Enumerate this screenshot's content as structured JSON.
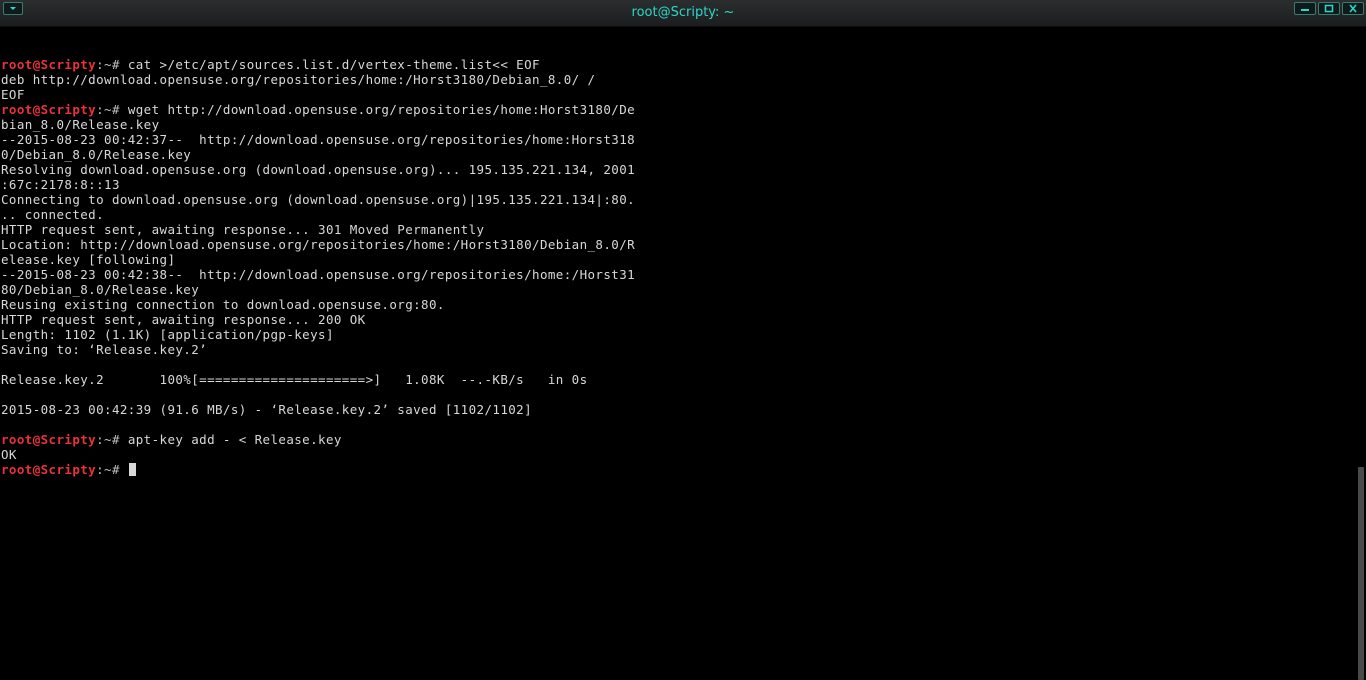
{
  "window": {
    "title": "root@Scripty: ~"
  },
  "icons": {
    "menu": "chevron-down-icon",
    "minimize": "minimize-icon",
    "maximize": "maximize-icon",
    "close": "close-icon"
  },
  "colors": {
    "title": "#2fd6c8",
    "prompt_user": "#e8333a",
    "text": "#d8d8d8",
    "background": "#000000"
  },
  "terminal": {
    "prompt": {
      "user": "root",
      "host": "@Scripty",
      "suffix": ":~#"
    },
    "lines": [
      {
        "cmd": " cat >/etc/apt/sources.list.d/vertex-theme.list<< EOF"
      },
      {
        "text": "deb http://download.opensuse.org/repositories/home:/Horst3180/Debian_8.0/ /"
      },
      {
        "text": "EOF"
      },
      {
        "cmd": " wget http://download.opensuse.org/repositories/home:Horst3180/De"
      },
      {
        "text": "bian_8.0/Release.key"
      },
      {
        "text": "--2015-08-23 00:42:37--  http://download.opensuse.org/repositories/home:Horst318"
      },
      {
        "text": "0/Debian_8.0/Release.key"
      },
      {
        "text": "Resolving download.opensuse.org (download.opensuse.org)... 195.135.221.134, 2001"
      },
      {
        "text": ":67c:2178:8::13"
      },
      {
        "text": "Connecting to download.opensuse.org (download.opensuse.org)|195.135.221.134|:80."
      },
      {
        "text": ".. connected."
      },
      {
        "text": "HTTP request sent, awaiting response... 301 Moved Permanently"
      },
      {
        "text": "Location: http://download.opensuse.org/repositories/home:/Horst3180/Debian_8.0/R"
      },
      {
        "text": "elease.key [following]"
      },
      {
        "text": "--2015-08-23 00:42:38--  http://download.opensuse.org/repositories/home:/Horst31"
      },
      {
        "text": "80/Debian_8.0/Release.key"
      },
      {
        "text": "Reusing existing connection to download.opensuse.org:80."
      },
      {
        "text": "HTTP request sent, awaiting response... 200 OK"
      },
      {
        "text": "Length: 1102 (1.1K) [application/pgp-keys]"
      },
      {
        "text": "Saving to: ‘Release.key.2’"
      },
      {
        "text": ""
      },
      {
        "text": "Release.key.2       100%[=====================>]   1.08K  --.-KB/s   in 0s"
      },
      {
        "text": ""
      },
      {
        "text": "2015-08-23 00:42:39 (91.6 MB/s) - ‘Release.key.2’ saved [1102/1102]"
      },
      {
        "text": ""
      },
      {
        "cmd": " apt-key add - < Release.key"
      },
      {
        "text": "OK"
      },
      {
        "cmd": " ",
        "cursor": true
      }
    ]
  }
}
